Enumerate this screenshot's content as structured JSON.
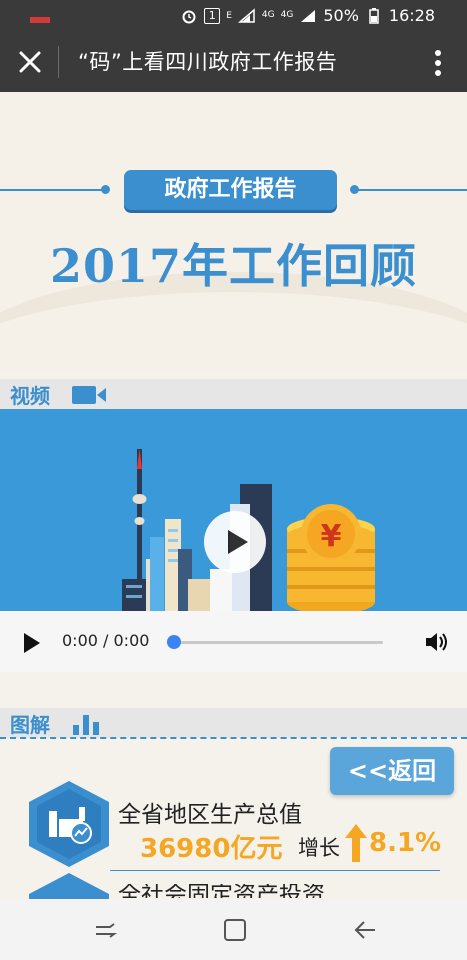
{
  "status_bar": {
    "battery": "50%",
    "time": "16:28",
    "sim": "1",
    "network_1": "4G",
    "network_2": "4G",
    "network_3": "E"
  },
  "app_bar": {
    "title": "“码”上看四川政府工作报告"
  },
  "banner": {
    "badge": "政府工作报告",
    "headline": "2017年工作回顾"
  },
  "video_section": {
    "label": "视频",
    "currency_symbol": "¥",
    "time_display": "0:00 / 0:00"
  },
  "infographic_section": {
    "label": "图解",
    "back_button": "<<返回",
    "items": [
      {
        "title": "全省地区生产总值",
        "value": "36980亿元",
        "growth_label": "增长",
        "growth_value": "8.1%"
      },
      {
        "title": "全社会固定资产投资"
      }
    ]
  },
  "colors": {
    "primary_blue": "#3b8fcf",
    "accent_orange": "#f5a623",
    "bar_dark": "#3a3a3a"
  }
}
